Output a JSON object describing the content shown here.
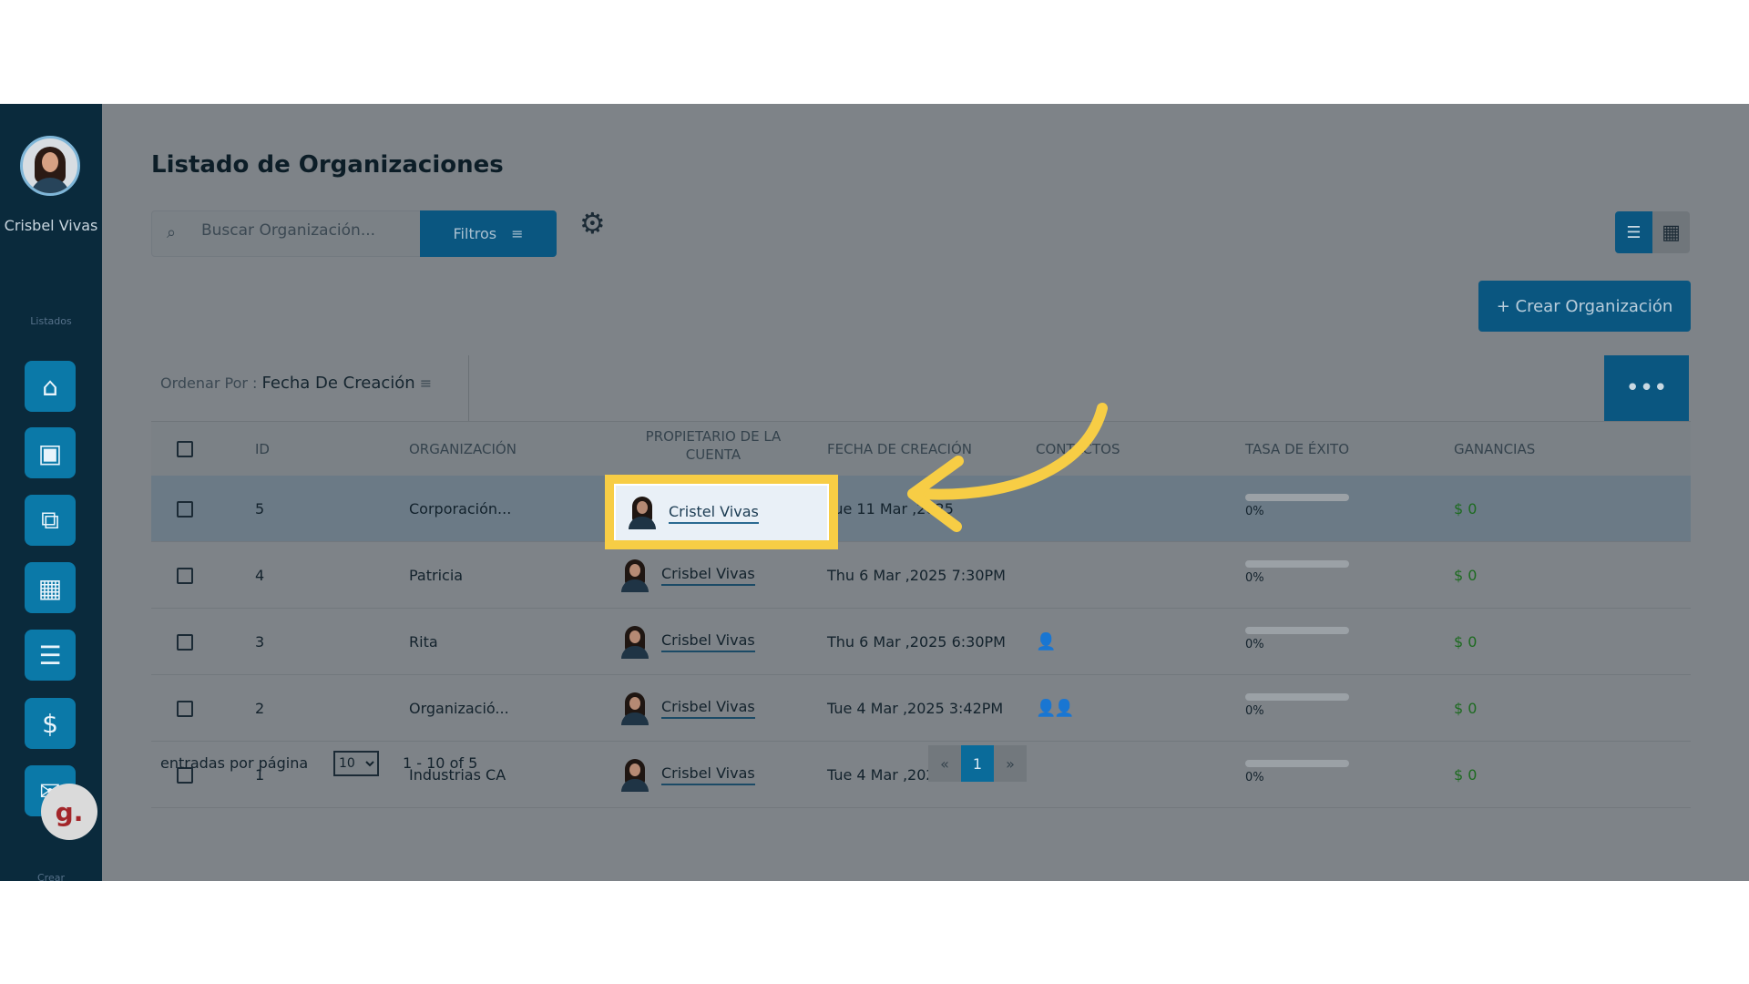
{
  "sidebar": {
    "user_name": "Crisbel Vivas",
    "section_label": "Listados",
    "more_label": "Crear",
    "items": [
      {
        "icon": "home-icon",
        "glyph": "⌂"
      },
      {
        "icon": "contacts-book-icon",
        "glyph": "▣"
      },
      {
        "icon": "organization-chart-icon",
        "glyph": "⧉"
      },
      {
        "icon": "dashboard-grid-icon",
        "glyph": "▦"
      },
      {
        "icon": "list-icon",
        "glyph": "☰"
      },
      {
        "icon": "billing-icon",
        "glyph": "$"
      },
      {
        "icon": "mail-icon",
        "glyph": "✉"
      }
    ],
    "badge": "g."
  },
  "header": {
    "title": "Listado de Organizaciones",
    "search_placeholder": "Buscar Organización...",
    "filters_label": "Filtros",
    "create_label": "+ Crear Organización"
  },
  "toolbar": {
    "sort_prefix": "Ordenar Por :",
    "sort_value": "Fecha De Creación",
    "more_label": "•••"
  },
  "table": {
    "columns": [
      "ID",
      "ORGANIZACIÓN",
      "PROPIETARIO DE LA CUENTA",
      "FECHA DE CREACIÓN",
      "CONTACTOS",
      "TASA DE ÉXITO",
      "GANANCIAS"
    ],
    "rows": [
      {
        "id": "5",
        "org": "Corporación...",
        "owner": "Cristel Vivas",
        "date": "Tue 11 Mar ,2025",
        "contacts": "",
        "rate": "0%",
        "rate_value": 0,
        "earnings": "$ 0",
        "selected": true
      },
      {
        "id": "4",
        "org": "Patricia",
        "owner": "Crisbel Vivas",
        "date": "Thu 6 Mar ,2025 7:30PM",
        "contacts": "",
        "rate": "0%",
        "rate_value": 0,
        "earnings": "$ 0",
        "selected": false
      },
      {
        "id": "3",
        "org": "Rita",
        "owner": "Crisbel Vivas",
        "date": "Thu 6 Mar ,2025 6:30PM",
        "contacts": "👤",
        "rate": "0%",
        "rate_value": 0,
        "earnings": "$ 0",
        "selected": false
      },
      {
        "id": "2",
        "org": "Organizació...",
        "owner": "Crisbel Vivas",
        "date": "Tue 4 Mar ,2025 3:42PM",
        "contacts": "👤👤",
        "rate": "0%",
        "rate_value": 0,
        "earnings": "$ 0",
        "selected": false
      },
      {
        "id": "1",
        "org": "Industrias CA",
        "owner": "Crisbel Vivas",
        "date": "Tue 4 Mar ,2025 3:41PM",
        "contacts": "",
        "rate": "0%",
        "rate_value": 0,
        "earnings": "$ 0",
        "selected": false
      }
    ]
  },
  "footer": {
    "per_page_label": "entradas por página",
    "per_page_value": "10",
    "range_label": "1 - 10 of 5",
    "prev": "«",
    "current_page": "1",
    "next": "»"
  },
  "highlight": {
    "owner": "Cristel Vivas",
    "color": "#f7cd45"
  },
  "colors": {
    "accent": "#0b79a8",
    "sidebar": "#0a2a3c",
    "money": "#1d6b20"
  }
}
